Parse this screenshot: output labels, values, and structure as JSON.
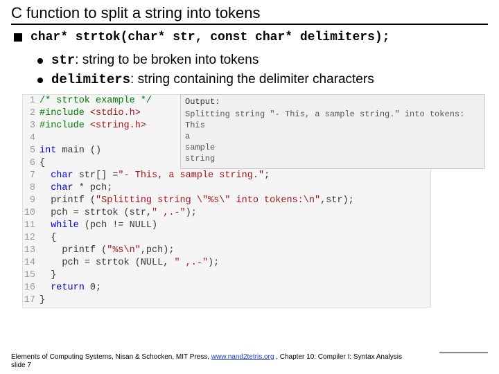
{
  "title": "C function to split a string into tokens",
  "signature": "char* strtok(char* str, const char* delimiters);",
  "bullets": {
    "str_code": "str",
    "str_rest": ": string to be broken into tokens",
    "del_code": "delimiters",
    "del_rest": ": string containing the delimiter characters"
  },
  "code": [
    {
      "n": "1",
      "pre": "",
      "html": "<span class=\"cm\">/* strtok example */</span>"
    },
    {
      "n": "2",
      "pre": "",
      "html": "<span class=\"pp\">#include</span> <span class=\"inc\">&lt;stdio.h&gt;</span>"
    },
    {
      "n": "3",
      "pre": "",
      "html": "<span class=\"pp\">#include</span> <span class=\"inc\">&lt;string.h&gt;</span>"
    },
    {
      "n": "4",
      "pre": "",
      "html": ""
    },
    {
      "n": "5",
      "pre": "",
      "html": "<span class=\"kw\">int</span> main ()"
    },
    {
      "n": "6",
      "pre": "",
      "html": "{"
    },
    {
      "n": "7",
      "pre": "  ",
      "html": "<span class=\"kw\">char</span> str[] =<span class=\"str\">\"- This, a sample string.\"</span>;"
    },
    {
      "n": "8",
      "pre": "  ",
      "html": "<span class=\"kw\">char</span> * pch;"
    },
    {
      "n": "9",
      "pre": "  ",
      "html": "printf (<span class=\"str\">\"Splitting string \\\"%s\\\" into tokens:\\n\"</span>,str);"
    },
    {
      "n": "10",
      "pre": "  ",
      "html": "pch = strtok (str,<span class=\"str\">\" ,.-\"</span>);"
    },
    {
      "n": "11",
      "pre": "  ",
      "html": "<span class=\"kw\">while</span> (pch != NULL)"
    },
    {
      "n": "12",
      "pre": "  ",
      "html": "{"
    },
    {
      "n": "13",
      "pre": "    ",
      "html": "printf (<span class=\"str\">\"%s\\n\"</span>,pch);"
    },
    {
      "n": "14",
      "pre": "    ",
      "html": "pch = strtok (NULL, <span class=\"str\">\" ,.-\"</span>);"
    },
    {
      "n": "15",
      "pre": "  ",
      "html": "}"
    },
    {
      "n": "16",
      "pre": "  ",
      "html": "<span class=\"kw\">return</span> 0;"
    },
    {
      "n": "17",
      "pre": "",
      "html": "}"
    }
  ],
  "output": {
    "title": "Output:",
    "lines": [
      "Splitting string \"- This, a sample string.\" into tokens:",
      "This",
      "a",
      "sample",
      "string"
    ]
  },
  "footer": {
    "pre": "Elements of Computing Systems, Nisan & Schocken, MIT Press, ",
    "link": "www.nand2tetris.org",
    "post": " , Chapter 10: Compiler I: Syntax Analysis",
    "slide": "slide 7"
  }
}
